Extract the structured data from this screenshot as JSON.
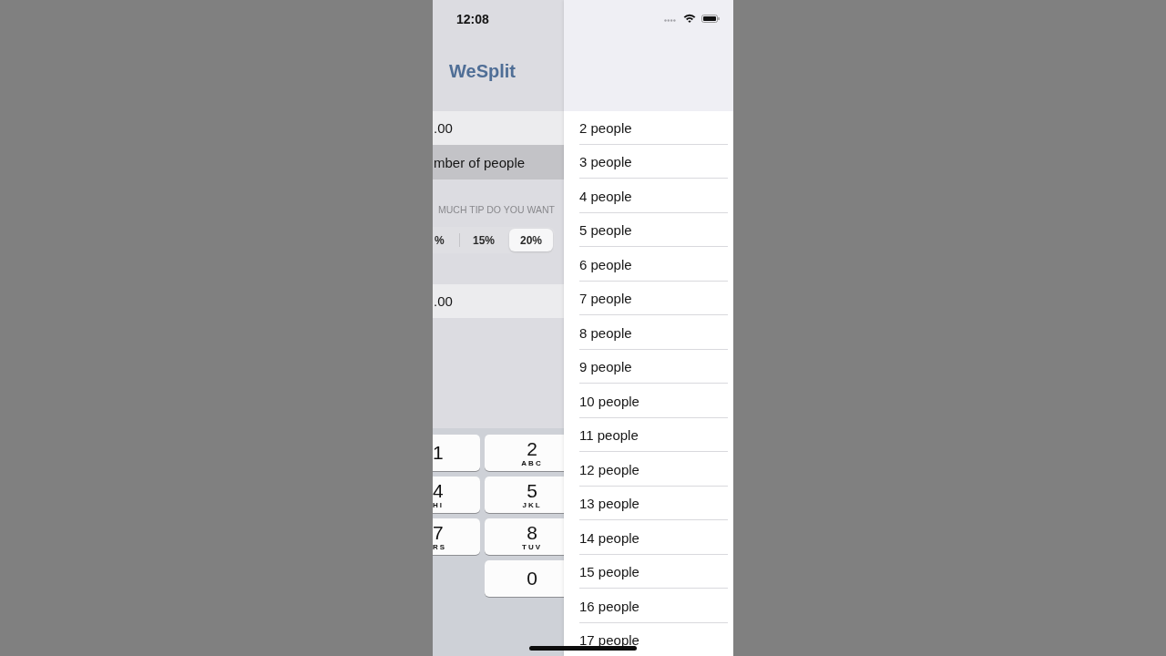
{
  "status_bar": {
    "time": "12:08"
  },
  "previous_screen": {
    "title": "WeSplit",
    "amount_field": {
      "value": ".00"
    },
    "people_row": {
      "label": "mber of people",
      "selected": true
    },
    "tip_section": {
      "header": "MUCH TIP DO YOU WANT",
      "segments": [
        {
          "label": "%",
          "selected": false
        },
        {
          "label": "15%",
          "selected": false
        },
        {
          "label": "20%",
          "selected": true
        }
      ]
    },
    "total_row": {
      "value": ".00"
    }
  },
  "keyboard": {
    "rows": [
      {
        "keys": [
          {
            "digit": "1"
          },
          {
            "digit": "2",
            "letters": "ABC"
          }
        ]
      },
      {
        "keys": [
          {
            "digit": "4",
            "letters": "HI"
          },
          {
            "digit": "5",
            "letters": "JKL"
          }
        ]
      },
      {
        "keys": [
          {
            "digit": "7",
            "letters": "RS"
          },
          {
            "digit": "8",
            "letters": "TUV"
          }
        ]
      },
      {
        "keys": [
          {
            "digit": "0"
          }
        ]
      }
    ]
  },
  "picker_list": {
    "options": [
      {
        "label": "2 people"
      },
      {
        "label": "3 people"
      },
      {
        "label": "4 people"
      },
      {
        "label": "5 people"
      },
      {
        "label": "6 people"
      },
      {
        "label": "7 people"
      },
      {
        "label": "8 people"
      },
      {
        "label": "9 people"
      },
      {
        "label": "10 people"
      },
      {
        "label": "11 people"
      },
      {
        "label": "12 people"
      },
      {
        "label": "13 people"
      },
      {
        "label": "14 people"
      },
      {
        "label": "15 people"
      },
      {
        "label": "16 people"
      },
      {
        "label": "17 people"
      }
    ]
  }
}
